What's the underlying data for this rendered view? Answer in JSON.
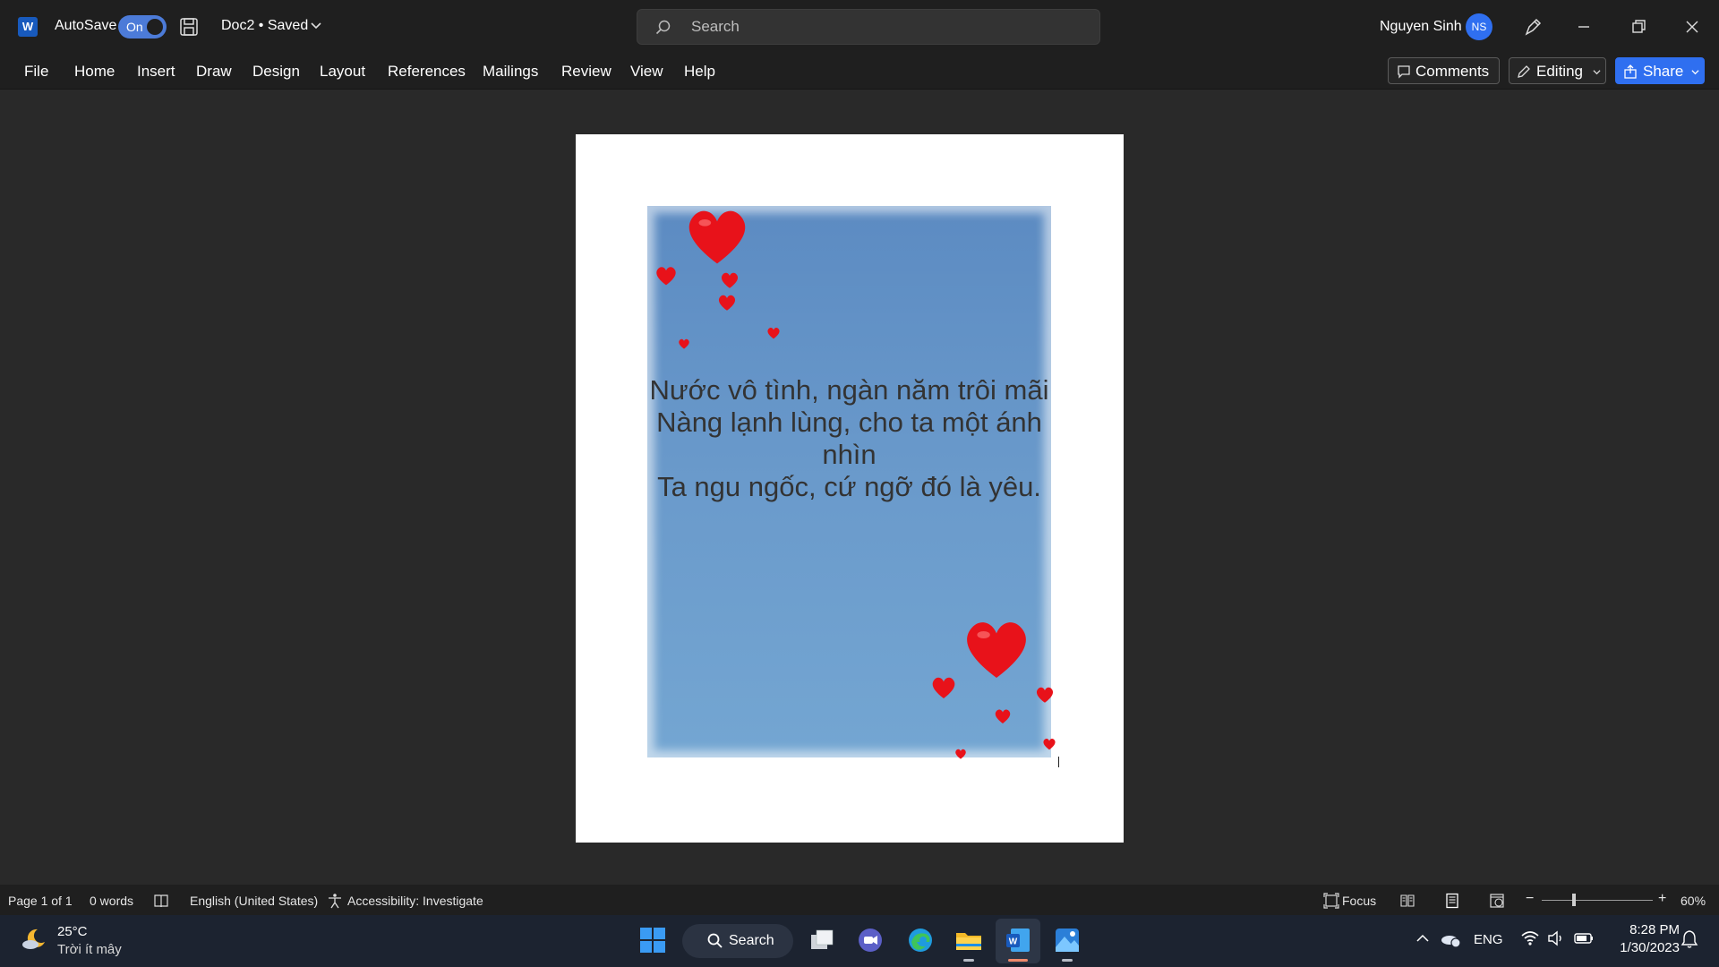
{
  "titlebar": {
    "app_logo": "W",
    "autosave_label": "AutoSave",
    "autosave_state": "On",
    "doc_title": "Doc2 • Saved",
    "search_placeholder": "Search",
    "user_name": "Nguyen Sinh",
    "user_initials": "NS"
  },
  "ribbon": {
    "tabs": [
      "File",
      "Home",
      "Insert",
      "Draw",
      "Design",
      "Layout",
      "References",
      "Mailings",
      "Review",
      "View",
      "Help"
    ],
    "comments_label": "Comments",
    "editing_label": "Editing",
    "share_label": "Share"
  },
  "document": {
    "poem_lines": [
      "Nước vô tình, ngàn năm trôi mãi",
      "Nàng lạnh lùng, cho ta một ánh nhìn",
      "Ta ngu ngốc, cứ ngỡ đó là yêu."
    ],
    "heart_color": "#e8121a",
    "card_color": "#6a9acb"
  },
  "statusbar": {
    "page": "Page 1 of 1",
    "words": "0 words",
    "language": "English (United States)",
    "accessibility": "Accessibility: Investigate",
    "focus": "Focus",
    "zoom": "60%"
  },
  "taskbar": {
    "temperature": "25°C",
    "condition": "Trời ít mây",
    "search_label": "Search",
    "language": "ENG",
    "time": "8:28 PM",
    "date": "1/30/2023"
  }
}
